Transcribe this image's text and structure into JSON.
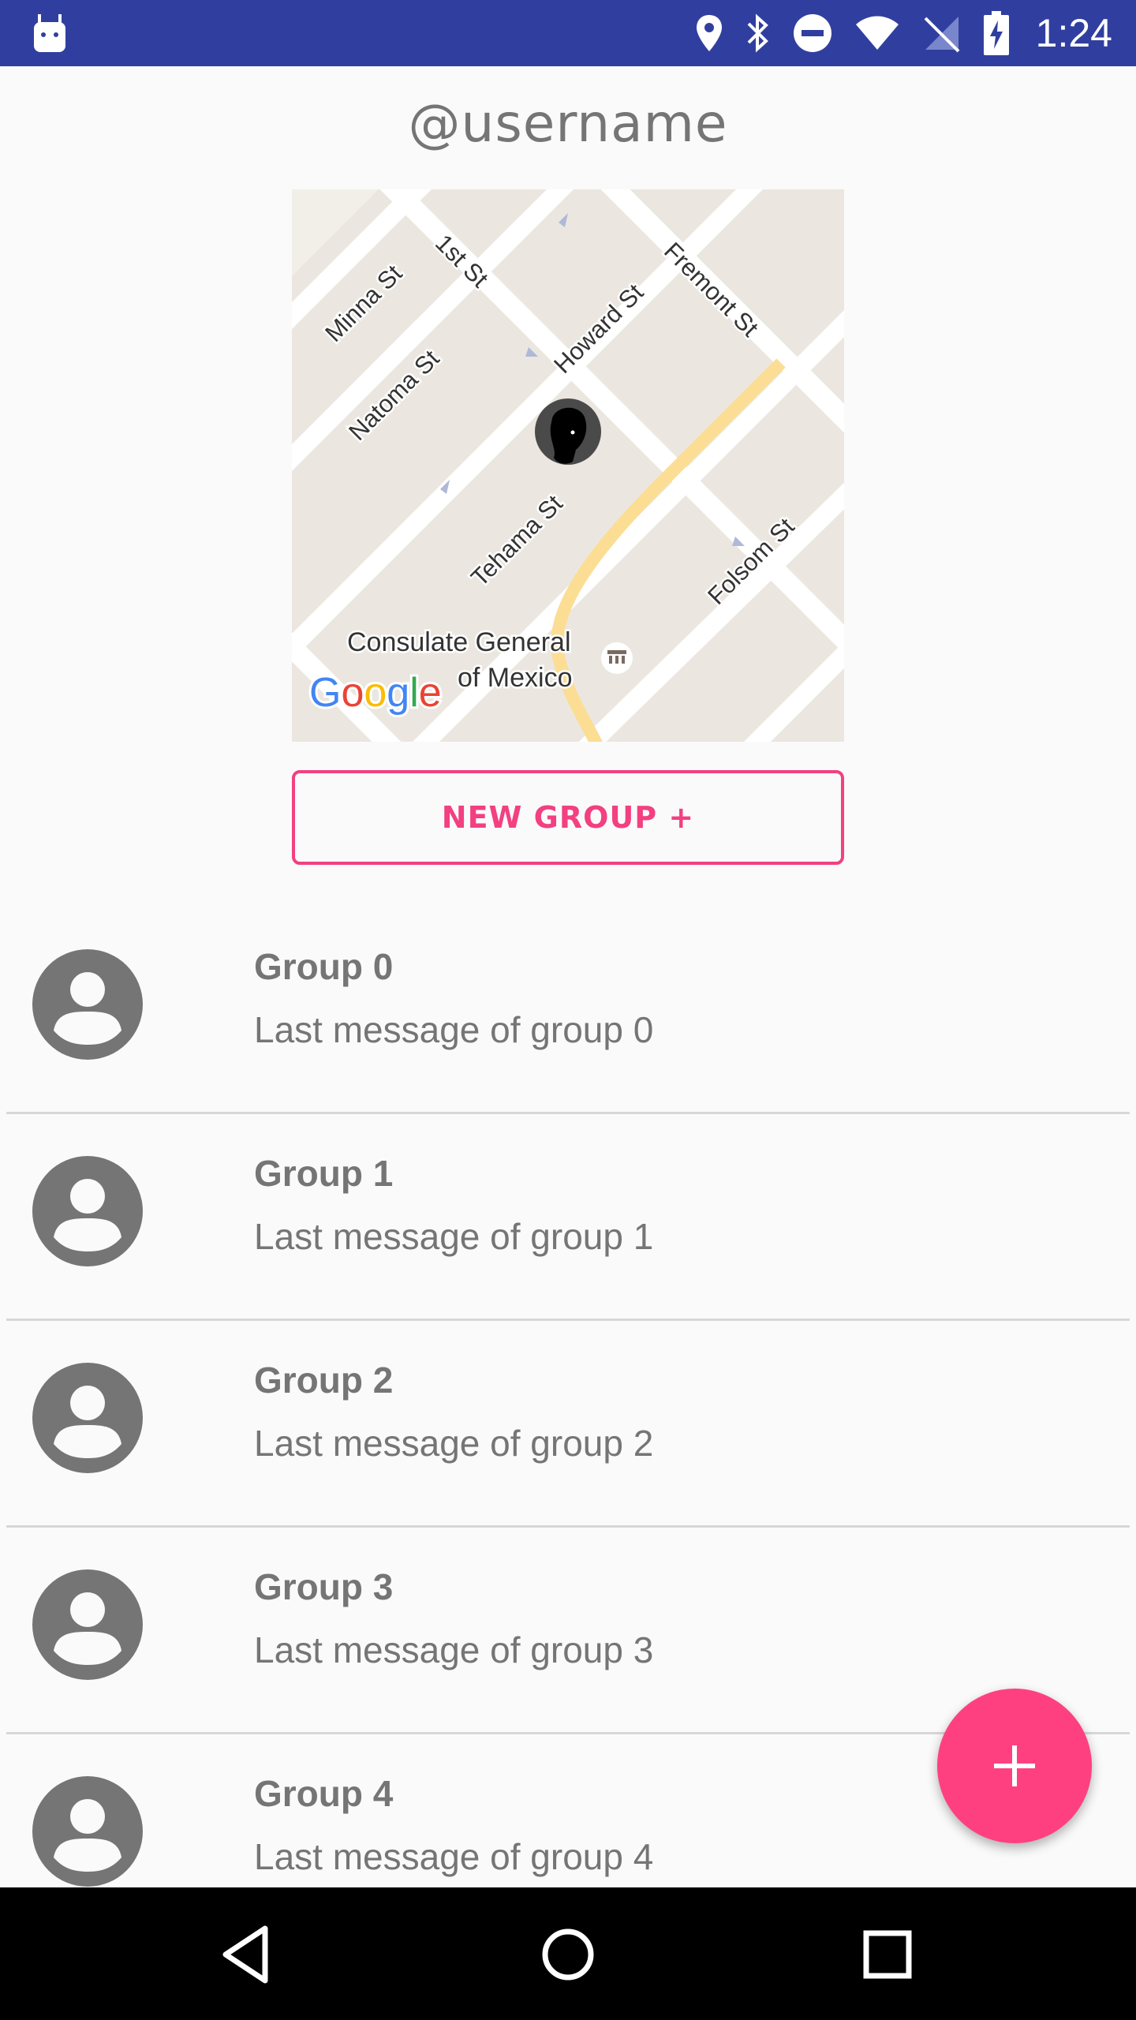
{
  "status_bar": {
    "time": "1:24",
    "icons": [
      "android-icon",
      "location-pin-icon",
      "bluetooth-icon",
      "do-not-disturb-icon",
      "wifi-icon",
      "no-signal-icon",
      "battery-charging-icon"
    ]
  },
  "header": {
    "title": "@username"
  },
  "map": {
    "street_labels": [
      "Minna St",
      "1st St",
      "Natoma St",
      "Howard St",
      "Fremont St",
      "Tehama St",
      "Folsom St"
    ],
    "poi_label_line1": "Consulate General",
    "poi_label_line2": "of Mexico",
    "logo_text": "Google"
  },
  "new_group_button": {
    "label": "NEW GROUP +"
  },
  "groups": [
    {
      "name": "Group 0",
      "message": "Last message of group 0"
    },
    {
      "name": "Group 1",
      "message": "Last message of group 1"
    },
    {
      "name": "Group 2",
      "message": "Last message of group 2"
    },
    {
      "name": "Group 3",
      "message": "Last message of group 3"
    },
    {
      "name": "Group 4",
      "message": "Last message of group 4"
    }
  ],
  "fab": {
    "icon": "plus-icon"
  },
  "nav_bar": {
    "icons": [
      "back-icon",
      "home-icon",
      "recents-icon"
    ]
  },
  "colors": {
    "status_bar": "#303f9f",
    "accent": "#fe4081",
    "text_gray": "#757575",
    "background": "#fafafa"
  }
}
